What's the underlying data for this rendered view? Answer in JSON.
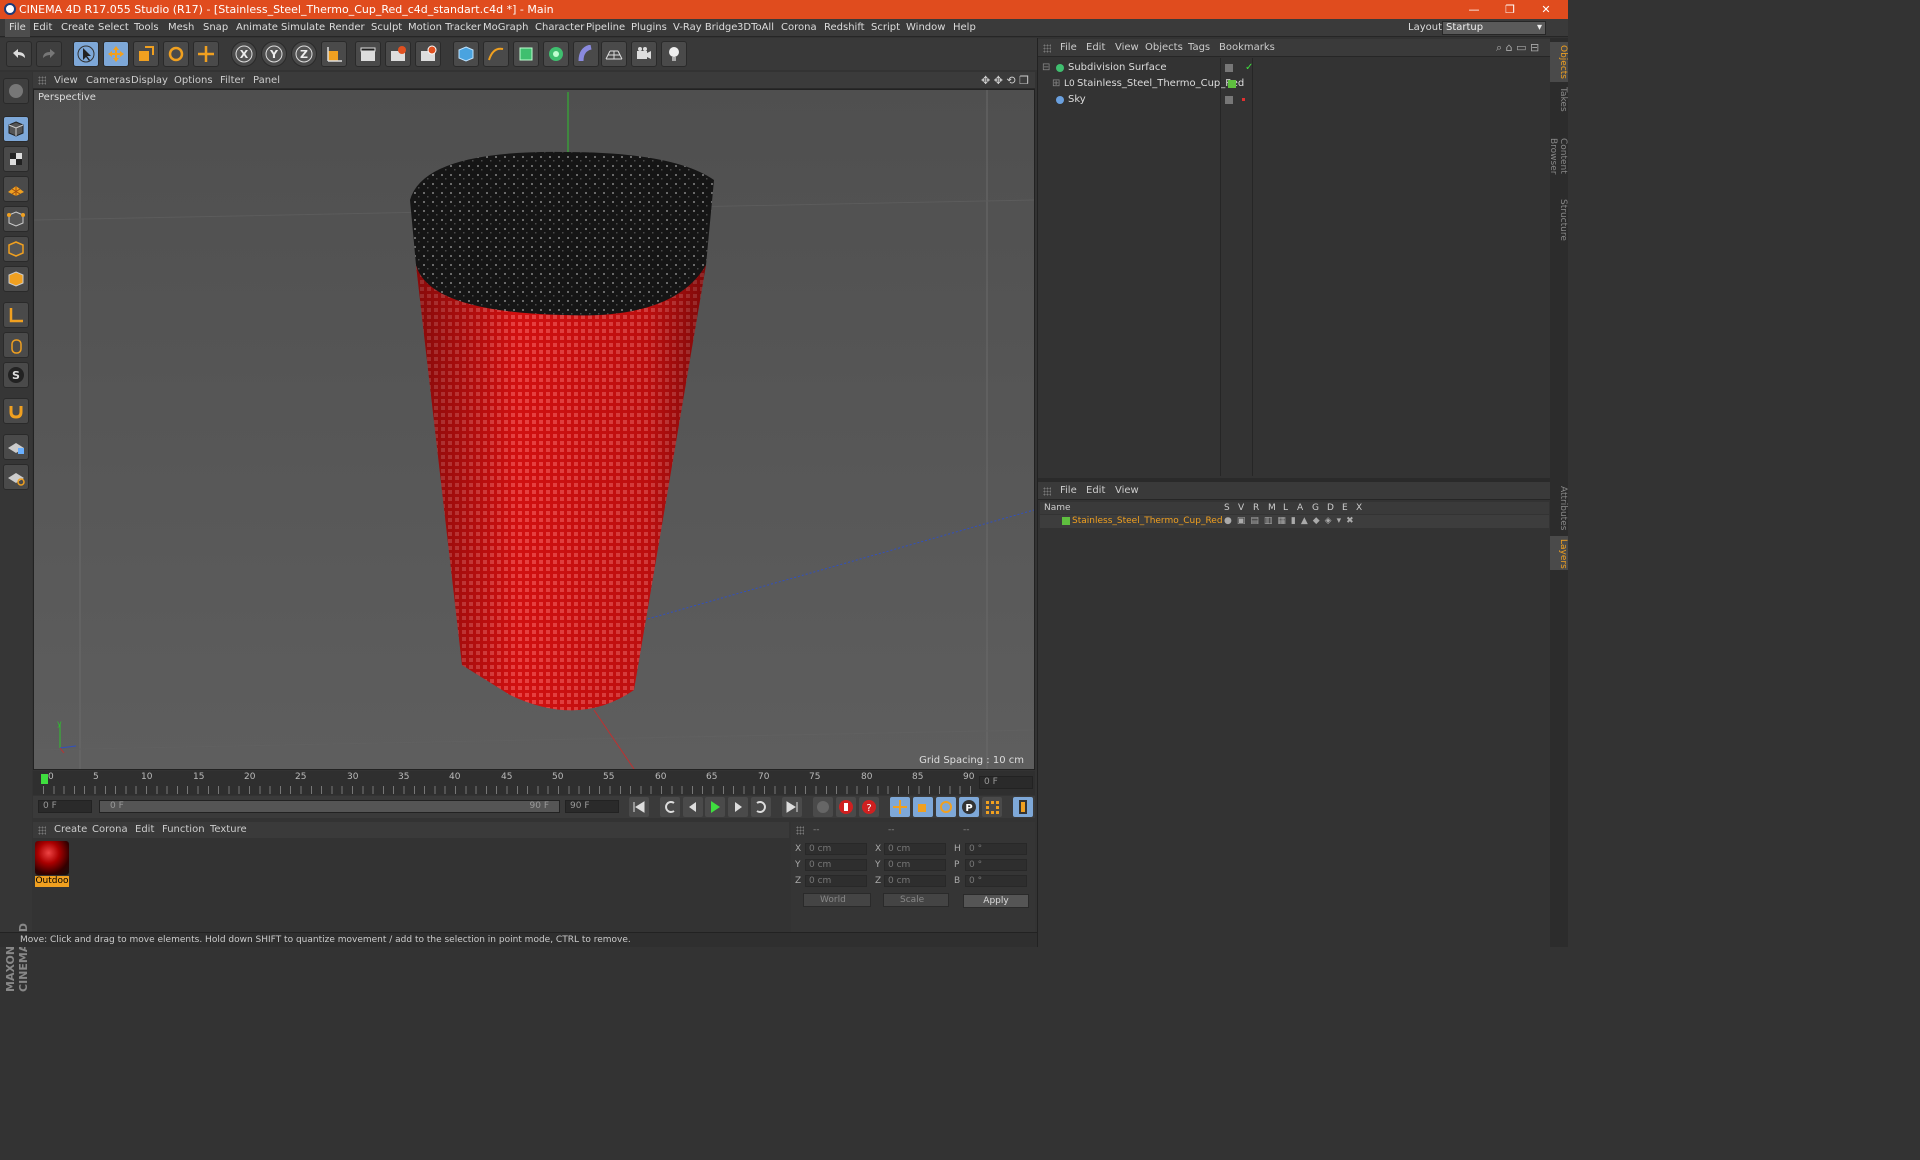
{
  "window": {
    "title": "CINEMA 4D R17.055 Studio (R17) - [Stainless_Steel_Thermo_Cup_Red_c4d_standart.c4d *] - Main",
    "controls": [
      "—",
      "❐",
      "✕"
    ]
  },
  "menubar": {
    "items": [
      "File",
      "Edit",
      "Create",
      "Select",
      "Tools",
      "Mesh",
      "Snap",
      "Animate",
      "Simulate",
      "Render",
      "Sculpt",
      "Motion Tracker",
      "MoGraph",
      "Character",
      "Pipeline",
      "Plugins",
      "V-Ray Bridge",
      "3DToAll",
      "Corona",
      "Redshift",
      "Script",
      "Window",
      "Help"
    ],
    "layout_label": "Layout:",
    "layout_value": "Startup"
  },
  "viewport": {
    "menu": [
      "View",
      "Cameras",
      "Display",
      "Options",
      "Filter",
      "Panel"
    ],
    "label": "Perspective",
    "grid_spacing": "Grid Spacing : 10 cm",
    "colors": {
      "cup_red": "#d11010",
      "lid_black": "#151515",
      "y_axis": "#2ec02e",
      "x_axis": "#c03030",
      "z_axis": "#3050c0"
    }
  },
  "timeline": {
    "ticks": [
      "0",
      "5",
      "10",
      "15",
      "20",
      "25",
      "30",
      "35",
      "40",
      "45",
      "50",
      "55",
      "60",
      "65",
      "70",
      "75",
      "80",
      "85",
      "90"
    ],
    "end_frame_field": "0 F"
  },
  "transport": {
    "start_field": "0 F",
    "range_start": "0 F",
    "range_end": "90 F",
    "end_field": "90 F"
  },
  "material_manager": {
    "menu": [
      "Create",
      "Corona",
      "Edit",
      "Function",
      "Texture"
    ],
    "materials": [
      {
        "name": "Outdoo"
      }
    ]
  },
  "coordinates": {
    "headers": [
      "--",
      "--",
      "--"
    ],
    "rows": [
      {
        "a": "X",
        "av": "0 cm",
        "b": "X",
        "bv": "0 cm",
        "c": "H",
        "cv": "0 °"
      },
      {
        "a": "Y",
        "av": "0 cm",
        "b": "Y",
        "bv": "0 cm",
        "c": "P",
        "cv": "0 °"
      },
      {
        "a": "Z",
        "av": "0 cm",
        "b": "Z",
        "bv": "0 cm",
        "c": "B",
        "cv": "0 °"
      }
    ],
    "space": "World",
    "mode": "Scale",
    "apply_label": "Apply"
  },
  "status": "Move: Click and drag to move elements. Hold down SHIFT to quantize movement / add to the selection in point mode, CTRL to remove.",
  "object_manager": {
    "menu": [
      "File",
      "Edit",
      "View",
      "Objects",
      "Tags",
      "Bookmarks"
    ],
    "objects": [
      {
        "name": "Subdivision Surface"
      },
      {
        "name": "Stainless_Steel_Thermo_Cup_Red"
      },
      {
        "name": "Sky"
      }
    ]
  },
  "layer_manager": {
    "menu": [
      "File",
      "Edit",
      "View"
    ],
    "columns": [
      "Name",
      "S",
      "V",
      "R",
      "M",
      "L",
      "A",
      "G",
      "D",
      "E",
      "X"
    ],
    "layers": [
      {
        "name": "Stainless_Steel_Thermo_Cup_Red",
        "color": "#5fbf3f"
      }
    ]
  },
  "side_tabs": [
    "Objects",
    "Takes",
    "Content Browser",
    "Structure",
    "Attributes",
    "Layers"
  ]
}
